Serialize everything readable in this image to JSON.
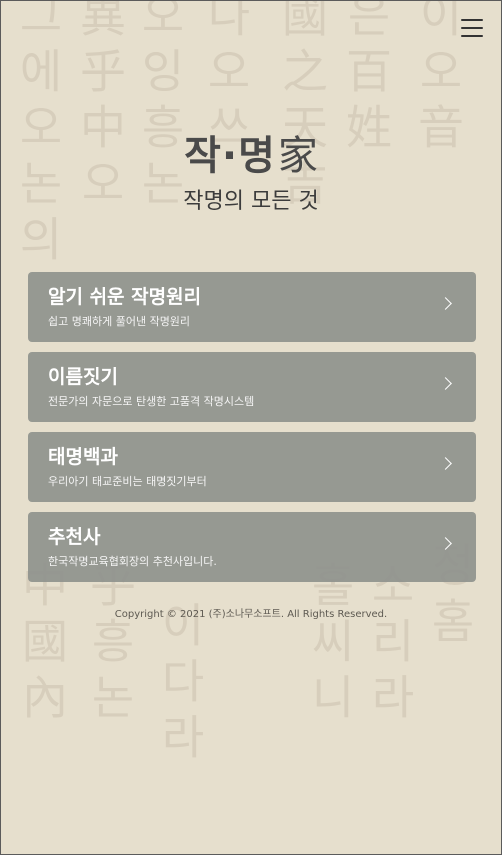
{
  "header": {
    "menu_icon": "hamburger-icon"
  },
  "logo": {
    "hangul": "작·명",
    "hanja": "家"
  },
  "tagline": "작명의 모든 것",
  "menu": [
    {
      "title": "알기 쉬운 작명원리",
      "subtitle": "쉽고 명쾌하게 풀어낸 작명원리"
    },
    {
      "title": "이름짓기",
      "subtitle": "전문가의 자문으로 탄생한 고품격 작명시스템"
    },
    {
      "title": "태명백과",
      "subtitle": "우리아기 태교준비는 태명짓기부터"
    },
    {
      "title": "추천사",
      "subtitle": "한국작명교육협회장의 추천사입니다."
    }
  ],
  "footer": {
    "copyright": "Copyright © 2021 (주)소나무소프트. All Rights Reserved."
  },
  "colors": {
    "background": "#e6dfcd",
    "card": "#8f928d",
    "text_dark": "#3c3c3c"
  }
}
